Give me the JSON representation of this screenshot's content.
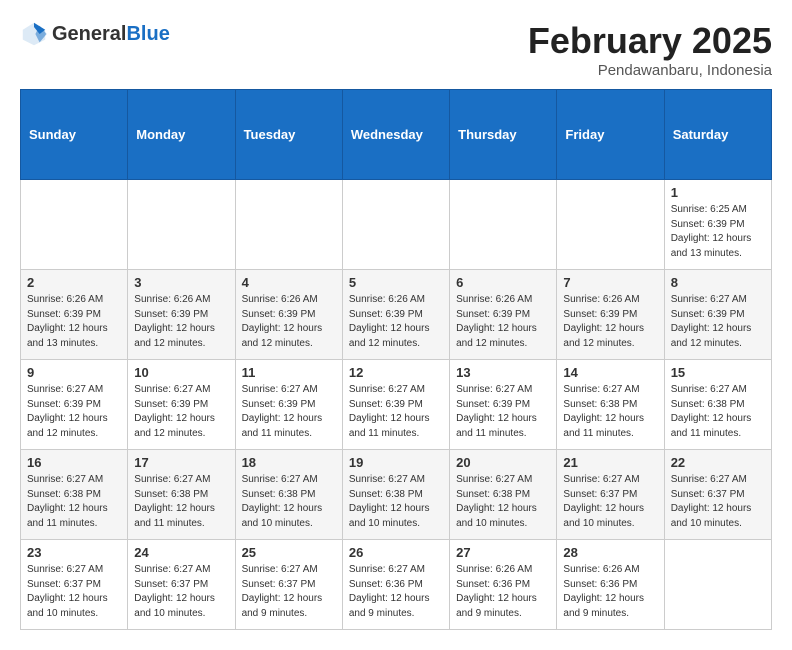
{
  "header": {
    "logo_general": "General",
    "logo_blue": "Blue",
    "month_title": "February 2025",
    "location": "Pendawanbaru, Indonesia"
  },
  "days_of_week": [
    "Sunday",
    "Monday",
    "Tuesday",
    "Wednesday",
    "Thursday",
    "Friday",
    "Saturday"
  ],
  "weeks": [
    [
      {
        "day": "",
        "info": ""
      },
      {
        "day": "",
        "info": ""
      },
      {
        "day": "",
        "info": ""
      },
      {
        "day": "",
        "info": ""
      },
      {
        "day": "",
        "info": ""
      },
      {
        "day": "",
        "info": ""
      },
      {
        "day": "1",
        "info": "Sunrise: 6:25 AM\nSunset: 6:39 PM\nDaylight: 12 hours\nand 13 minutes."
      }
    ],
    [
      {
        "day": "2",
        "info": "Sunrise: 6:26 AM\nSunset: 6:39 PM\nDaylight: 12 hours\nand 13 minutes."
      },
      {
        "day": "3",
        "info": "Sunrise: 6:26 AM\nSunset: 6:39 PM\nDaylight: 12 hours\nand 12 minutes."
      },
      {
        "day": "4",
        "info": "Sunrise: 6:26 AM\nSunset: 6:39 PM\nDaylight: 12 hours\nand 12 minutes."
      },
      {
        "day": "5",
        "info": "Sunrise: 6:26 AM\nSunset: 6:39 PM\nDaylight: 12 hours\nand 12 minutes."
      },
      {
        "day": "6",
        "info": "Sunrise: 6:26 AM\nSunset: 6:39 PM\nDaylight: 12 hours\nand 12 minutes."
      },
      {
        "day": "7",
        "info": "Sunrise: 6:26 AM\nSunset: 6:39 PM\nDaylight: 12 hours\nand 12 minutes."
      },
      {
        "day": "8",
        "info": "Sunrise: 6:27 AM\nSunset: 6:39 PM\nDaylight: 12 hours\nand 12 minutes."
      }
    ],
    [
      {
        "day": "9",
        "info": "Sunrise: 6:27 AM\nSunset: 6:39 PM\nDaylight: 12 hours\nand 12 minutes."
      },
      {
        "day": "10",
        "info": "Sunrise: 6:27 AM\nSunset: 6:39 PM\nDaylight: 12 hours\nand 12 minutes."
      },
      {
        "day": "11",
        "info": "Sunrise: 6:27 AM\nSunset: 6:39 PM\nDaylight: 12 hours\nand 11 minutes."
      },
      {
        "day": "12",
        "info": "Sunrise: 6:27 AM\nSunset: 6:39 PM\nDaylight: 12 hours\nand 11 minutes."
      },
      {
        "day": "13",
        "info": "Sunrise: 6:27 AM\nSunset: 6:39 PM\nDaylight: 12 hours\nand 11 minutes."
      },
      {
        "day": "14",
        "info": "Sunrise: 6:27 AM\nSunset: 6:38 PM\nDaylight: 12 hours\nand 11 minutes."
      },
      {
        "day": "15",
        "info": "Sunrise: 6:27 AM\nSunset: 6:38 PM\nDaylight: 12 hours\nand 11 minutes."
      }
    ],
    [
      {
        "day": "16",
        "info": "Sunrise: 6:27 AM\nSunset: 6:38 PM\nDaylight: 12 hours\nand 11 minutes."
      },
      {
        "day": "17",
        "info": "Sunrise: 6:27 AM\nSunset: 6:38 PM\nDaylight: 12 hours\nand 11 minutes."
      },
      {
        "day": "18",
        "info": "Sunrise: 6:27 AM\nSunset: 6:38 PM\nDaylight: 12 hours\nand 10 minutes."
      },
      {
        "day": "19",
        "info": "Sunrise: 6:27 AM\nSunset: 6:38 PM\nDaylight: 12 hours\nand 10 minutes."
      },
      {
        "day": "20",
        "info": "Sunrise: 6:27 AM\nSunset: 6:38 PM\nDaylight: 12 hours\nand 10 minutes."
      },
      {
        "day": "21",
        "info": "Sunrise: 6:27 AM\nSunset: 6:37 PM\nDaylight: 12 hours\nand 10 minutes."
      },
      {
        "day": "22",
        "info": "Sunrise: 6:27 AM\nSunset: 6:37 PM\nDaylight: 12 hours\nand 10 minutes."
      }
    ],
    [
      {
        "day": "23",
        "info": "Sunrise: 6:27 AM\nSunset: 6:37 PM\nDaylight: 12 hours\nand 10 minutes."
      },
      {
        "day": "24",
        "info": "Sunrise: 6:27 AM\nSunset: 6:37 PM\nDaylight: 12 hours\nand 10 minutes."
      },
      {
        "day": "25",
        "info": "Sunrise: 6:27 AM\nSunset: 6:37 PM\nDaylight: 12 hours\nand 9 minutes."
      },
      {
        "day": "26",
        "info": "Sunrise: 6:27 AM\nSunset: 6:36 PM\nDaylight: 12 hours\nand 9 minutes."
      },
      {
        "day": "27",
        "info": "Sunrise: 6:26 AM\nSunset: 6:36 PM\nDaylight: 12 hours\nand 9 minutes."
      },
      {
        "day": "28",
        "info": "Sunrise: 6:26 AM\nSunset: 6:36 PM\nDaylight: 12 hours\nand 9 minutes."
      },
      {
        "day": "",
        "info": ""
      }
    ]
  ]
}
